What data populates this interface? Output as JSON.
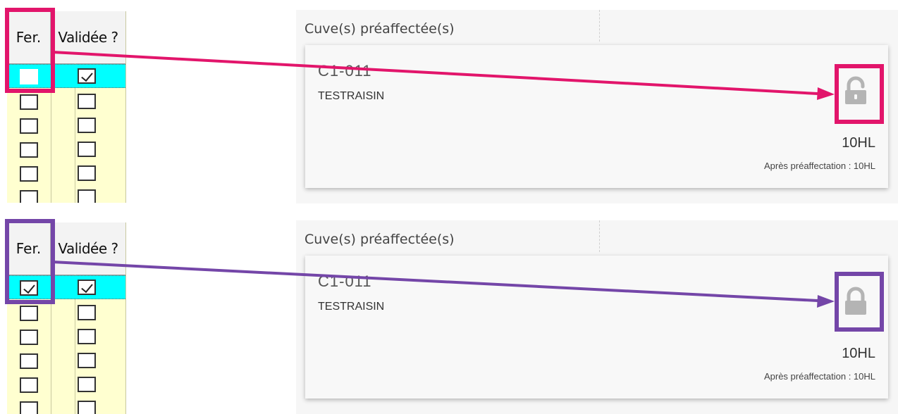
{
  "colors": {
    "annotation_top": "#e2156b",
    "annotation_bottom": "#7446a8",
    "grid_bg": "#ffffd0",
    "selected_row": "#00ffff",
    "lock_icon": "#b4b4b4"
  },
  "panels": [
    {
      "grid": {
        "col_fer": "Fer.",
        "col_validee": "Validée ?",
        "selected_fer_checked": false,
        "selected_validee_checked": true
      },
      "card": {
        "section_title": "Cuve(s) préaffectée(s)",
        "code": "C1-011",
        "label": "TESTRAISIN",
        "volume": "10HL",
        "after_label": "Après préaffectation : 10HL",
        "lock_icon": "lock-open-icon"
      }
    },
    {
      "grid": {
        "col_fer": "Fer.",
        "col_validee": "Validée ?",
        "selected_fer_checked": true,
        "selected_validee_checked": true
      },
      "card": {
        "section_title": "Cuve(s) préaffectée(s)",
        "code": "C1-011",
        "label": "TESTRAISIN",
        "volume": "10HL",
        "after_label": "Après préaffectation : 10HL",
        "lock_icon": "lock-closed-icon"
      }
    }
  ]
}
